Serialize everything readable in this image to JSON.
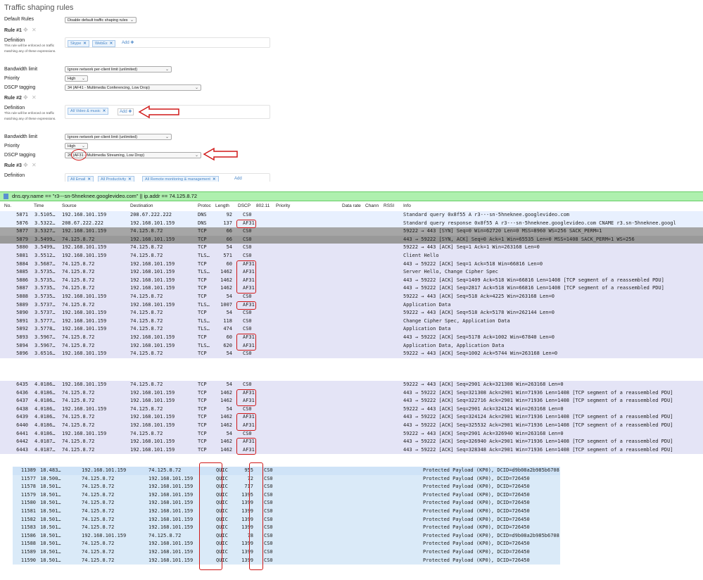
{
  "traffic_shaping": {
    "title": "Traffic shaping rules",
    "default_rules_label": "Default Rules",
    "default_rules_value": "Disable default traffic shaping rules",
    "rule1_title": "Rule #1",
    "rule2_title": "Rule #2",
    "rule3_title": "Rule #3",
    "definition_label": "Definition",
    "definition_hint": "This rule will be enforced on traffic matching any of these expressions.",
    "bandwidth_label": "Bandwidth limit",
    "bandwidth_value": "Ignore network per-client limit (unlimited)",
    "priority_label": "Priority",
    "priority_value": "High",
    "dscp_label": "DSCP tagging",
    "rule1_dscp": "34 (AF41 - Multimedia Conferencing, Low Drop)",
    "rule2_dscp_pre": "26 (",
    "rule2_dscp_hl": "AF31",
    "rule2_dscp_post": " - Multimedia Streaming, Low Drop)",
    "rule1_tags": [
      "Skype",
      "WebEx"
    ],
    "rule2_tags": [
      "All Video & music"
    ],
    "rule3_tags": [
      "All Email",
      "All Productivity",
      "All Remote monitoring & management"
    ],
    "add_label": "Add",
    "add_short": "Add"
  },
  "filter": {
    "text": "dns.qry.name == \"r3---sn-5hneknee.googlevideo.com\" || ip.addr == 74.125.8.72"
  },
  "columns": [
    "No.",
    "Time",
    "Source",
    "Destination",
    "Protoc",
    "Length",
    "DSCP",
    "802.11",
    "Priority",
    "Data rate",
    "Chann",
    "RSSI",
    "Info"
  ],
  "packets_1": [
    {
      "no": "5871",
      "time": "3.5105…",
      "src": "192.168.101.159",
      "dst": "208.67.222.222",
      "proto": "DNS",
      "len": "92",
      "dscp": "CS0",
      "info": "Standard query 0x8f55 A r3---sn-5hneknee.googlevideo.com"
    },
    {
      "no": "5876",
      "time": "3.5322…",
      "src": "208.67.222.222",
      "dst": "192.168.101.159",
      "proto": "DNS",
      "len": "137",
      "dscp": "AF31",
      "info": "Standard query response 0x8f55 A r3---sn-5hneknee.googlevideo.com CNAME r3.sn-5hneknee.googl"
    },
    {
      "no": "5877",
      "time": "3.5327…",
      "src": "192.168.101.159",
      "dst": "74.125.8.72",
      "proto": "TCP",
      "len": "66",
      "dscp": "CS0",
      "info": "59222 → 443 [SYN] Seq=0 Win=62720 Len=0 MSS=8960 WS=256 SACK_PERM=1"
    },
    {
      "no": "5879",
      "time": "3.5499…",
      "src": "74.125.8.72",
      "dst": "192.168.101.159",
      "proto": "TCP",
      "len": "66",
      "dscp": "CS0",
      "info": "443 → 59222 [SYN, ACK] Seq=0 Ack=1 Win=65535 Len=0 MSS=1408 SACK_PERM=1 WS=256"
    },
    {
      "no": "5880",
      "time": "3.5499…",
      "src": "192.168.101.159",
      "dst": "74.125.8.72",
      "proto": "TCP",
      "len": "54",
      "dscp": "CS0",
      "info": "59222 → 443 [ACK] Seq=1 Ack=1 Win=263168 Len=0"
    },
    {
      "no": "5881",
      "time": "3.5512…",
      "src": "192.168.101.159",
      "dst": "74.125.8.72",
      "proto": "TLS…",
      "len": "571",
      "dscp": "CS0",
      "info": "Client Hello"
    },
    {
      "no": "5884",
      "time": "3.5687…",
      "src": "74.125.8.72",
      "dst": "192.168.101.159",
      "proto": "TCP",
      "len": "60",
      "dscp": "AF31",
      "info": "443 → 59222 [ACK] Seq=1 Ack=518 Win=66816 Len=0"
    },
    {
      "no": "5885",
      "time": "3.5735…",
      "src": "74.125.8.72",
      "dst": "192.168.101.159",
      "proto": "TLS…",
      "len": "1462",
      "dscp": "AF31",
      "info": "Server Hello, Change Cipher Spec"
    },
    {
      "no": "5886",
      "time": "3.5735…",
      "src": "74.125.8.72",
      "dst": "192.168.101.159",
      "proto": "TCP",
      "len": "1462",
      "dscp": "AF31",
      "info": "443 → 59222 [ACK] Seq=1409 Ack=518 Win=66816 Len=1408 [TCP segment of a reassembled PDU]"
    },
    {
      "no": "5887",
      "time": "3.5735…",
      "src": "74.125.8.72",
      "dst": "192.168.101.159",
      "proto": "TCP",
      "len": "1462",
      "dscp": "AF31",
      "info": "443 → 59222 [ACK] Seq=2817 Ack=518 Win=66816 Len=1408 [TCP segment of a reassembled PDU]"
    },
    {
      "no": "5888",
      "time": "3.5735…",
      "src": "192.168.101.159",
      "dst": "74.125.8.72",
      "proto": "TCP",
      "len": "54",
      "dscp": "CS0",
      "info": "59222 → 443 [ACK] Seq=518 Ack=4225 Win=263168 Len=0"
    },
    {
      "no": "5889",
      "time": "3.5737…",
      "src": "74.125.8.72",
      "dst": "192.168.101.159",
      "proto": "TLS…",
      "len": "1007",
      "dscp": "AF31",
      "info": "Application Data"
    },
    {
      "no": "5890",
      "time": "3.5737…",
      "src": "192.168.101.159",
      "dst": "74.125.8.72",
      "proto": "TCP",
      "len": "54",
      "dscp": "CS0",
      "info": "59222 → 443 [ACK] Seq=518 Ack=5178 Win=262144 Len=0"
    },
    {
      "no": "5891",
      "time": "3.5777…",
      "src": "192.168.101.159",
      "dst": "74.125.8.72",
      "proto": "TLS…",
      "len": "118",
      "dscp": "CS0",
      "info": "Change Cipher Spec, Application Data"
    },
    {
      "no": "5892",
      "time": "3.5778…",
      "src": "192.168.101.159",
      "dst": "74.125.8.72",
      "proto": "TLS…",
      "len": "474",
      "dscp": "CS0",
      "info": "Application Data"
    },
    {
      "no": "5893",
      "time": "3.5967…",
      "src": "74.125.8.72",
      "dst": "192.168.101.159",
      "proto": "TCP",
      "len": "60",
      "dscp": "AF31",
      "info": "443 → 59222 [ACK] Seq=5178 Ack=1002 Win=67840 Len=0"
    },
    {
      "no": "5894",
      "time": "3.5967…",
      "src": "74.125.8.72",
      "dst": "192.168.101.159",
      "proto": "TLS…",
      "len": "620",
      "dscp": "AF31",
      "info": "Application Data, Application Data"
    },
    {
      "no": "5896",
      "time": "3.6516…",
      "src": "192.168.101.159",
      "dst": "74.125.8.72",
      "proto": "TCP",
      "len": "54",
      "dscp": "CS0",
      "info": "59222 → 443 [ACK] Seq=1002 Ack=5744 Win=263168 Len=0"
    }
  ],
  "packets_2": [
    {
      "no": "6435",
      "time": "4.0186…",
      "src": "192.168.101.159",
      "dst": "74.125.8.72",
      "proto": "TCP",
      "len": "54",
      "dscp": "CS0",
      "info": "59222 → 443 [ACK] Seq=2901 Ack=321308 Win=263168 Len=0"
    },
    {
      "no": "6436",
      "time": "4.0186…",
      "src": "74.125.8.72",
      "dst": "192.168.101.159",
      "proto": "TCP",
      "len": "1462",
      "dscp": "AF31",
      "info": "443 → 59222 [ACK] Seq=321308 Ack=2901 Win=71936 Len=1408 [TCP segment of a reassembled PDU]"
    },
    {
      "no": "6437",
      "time": "4.0186…",
      "src": "74.125.8.72",
      "dst": "192.168.101.159",
      "proto": "TCP",
      "len": "1462",
      "dscp": "AF31",
      "info": "443 → 59222 [ACK] Seq=322716 Ack=2901 Win=71936 Len=1408 [TCP segment of a reassembled PDU]"
    },
    {
      "no": "6438",
      "time": "4.0186…",
      "src": "192.168.101.159",
      "dst": "74.125.8.72",
      "proto": "TCP",
      "len": "54",
      "dscp": "CS0",
      "info": "59222 → 443 [ACK] Seq=2901 Ack=324124 Win=263168 Len=0"
    },
    {
      "no": "6439",
      "time": "4.0186…",
      "src": "74.125.8.72",
      "dst": "192.168.101.159",
      "proto": "TCP",
      "len": "1462",
      "dscp": "AF31",
      "info": "443 → 59222 [ACK] Seq=324124 Ack=2901 Win=71936 Len=1408 [TCP segment of a reassembled PDU]"
    },
    {
      "no": "6440",
      "time": "4.0186…",
      "src": "74.125.8.72",
      "dst": "192.168.101.159",
      "proto": "TCP",
      "len": "1462",
      "dscp": "AF31",
      "info": "443 → 59222 [ACK] Seq=325532 Ack=2901 Win=71936 Len=1408 [TCP segment of a reassembled PDU]"
    },
    {
      "no": "6441",
      "time": "4.0186…",
      "src": "192.168.101.159",
      "dst": "74.125.8.72",
      "proto": "TCP",
      "len": "54",
      "dscp": "CS0",
      "info": "59222 → 443 [ACK] Seq=2901 Ack=326940 Win=263168 Len=0"
    },
    {
      "no": "6442",
      "time": "4.0187…",
      "src": "74.125.8.72",
      "dst": "192.168.101.159",
      "proto": "TCP",
      "len": "1462",
      "dscp": "AF31",
      "info": "443 → 59222 [ACK] Seq=326940 Ack=2901 Win=71936 Len=1408 [TCP segment of a reassembled PDU]"
    },
    {
      "no": "6443",
      "time": "4.0187…",
      "src": "74.125.8.72",
      "dst": "192.168.101.159",
      "proto": "TCP",
      "len": "1462",
      "dscp": "AF31",
      "info": "443 → 59222 [ACK] Seq=328348 Ack=2901 Win=71936 Len=1408 [TCP segment of a reassembled PDU]"
    }
  ],
  "packets_3": [
    {
      "no": "11389",
      "time": "18.483…",
      "src": "192.168.101.159",
      "dst": "74.125.8.72",
      "proto": "QUIC",
      "len": "955",
      "dscp": "CS0",
      "info": "Protected Payload (KP0), DCID=d9b08a2b985b6708"
    },
    {
      "no": "11577",
      "time": "18.500…",
      "src": "74.125.8.72",
      "dst": "192.168.101.159",
      "proto": "QUIC",
      "len": "72",
      "dscp": "CS0",
      "info": "Protected Payload (KP0), DCID=726450"
    },
    {
      "no": "11578",
      "time": "18.501…",
      "src": "74.125.8.72",
      "dst": "192.168.101.159",
      "proto": "QUIC",
      "len": "717",
      "dscp": "CS0",
      "info": "Protected Payload (KP0), DCID=726450"
    },
    {
      "no": "11579",
      "time": "18.501…",
      "src": "74.125.8.72",
      "dst": "192.168.101.159",
      "proto": "QUIC",
      "len": "1395",
      "dscp": "CS0",
      "info": "Protected Payload (KP0), DCID=726450"
    },
    {
      "no": "11580",
      "time": "18.501…",
      "src": "74.125.8.72",
      "dst": "192.168.101.159",
      "proto": "QUIC",
      "len": "1399",
      "dscp": "CS0",
      "info": "Protected Payload (KP0), DCID=726450"
    },
    {
      "no": "11581",
      "time": "18.501…",
      "src": "74.125.8.72",
      "dst": "192.168.101.159",
      "proto": "QUIC",
      "len": "1399",
      "dscp": "CS0",
      "info": "Protected Payload (KP0), DCID=726450"
    },
    {
      "no": "11582",
      "time": "18.501…",
      "src": "74.125.8.72",
      "dst": "192.168.101.159",
      "proto": "QUIC",
      "len": "1399",
      "dscp": "CS0",
      "info": "Protected Payload (KP0), DCID=726450"
    },
    {
      "no": "11583",
      "time": "18.501…",
      "src": "74.125.8.72",
      "dst": "192.168.101.159",
      "proto": "QUIC",
      "len": "1399",
      "dscp": "CS0",
      "info": "Protected Payload (KP0), DCID=726450"
    },
    {
      "no": "11586",
      "time": "18.501…",
      "src": "192.168.101.159",
      "dst": "74.125.8.72",
      "proto": "QUIC",
      "len": "78",
      "dscp": "CS0",
      "info": "Protected Payload (KP0), DCID=d9b08a2b985b6708"
    },
    {
      "no": "11588",
      "time": "18.501…",
      "src": "74.125.8.72",
      "dst": "192.168.101.159",
      "proto": "QUIC",
      "len": "1399",
      "dscp": "CS0",
      "info": "Protected Payload (KP0), DCID=726450"
    },
    {
      "no": "11589",
      "time": "18.501…",
      "src": "74.125.8.72",
      "dst": "192.168.101.159",
      "proto": "QUIC",
      "len": "1399",
      "dscp": "CS0",
      "info": "Protected Payload (KP0), DCID=726450"
    },
    {
      "no": "11590",
      "time": "18.501…",
      "src": "74.125.8.72",
      "dst": "192.168.101.159",
      "proto": "QUIC",
      "len": "1399",
      "dscp": "CS0",
      "info": "Protected Payload (KP0), DCID=726450"
    }
  ],
  "colors": {
    "filter_bg": "#aef0ae",
    "annotation_red": "#d01818",
    "row_blue": "#e8f0fe",
    "row_lavender": "#e4e4f6",
    "row_selected": "#a6a6a6"
  }
}
